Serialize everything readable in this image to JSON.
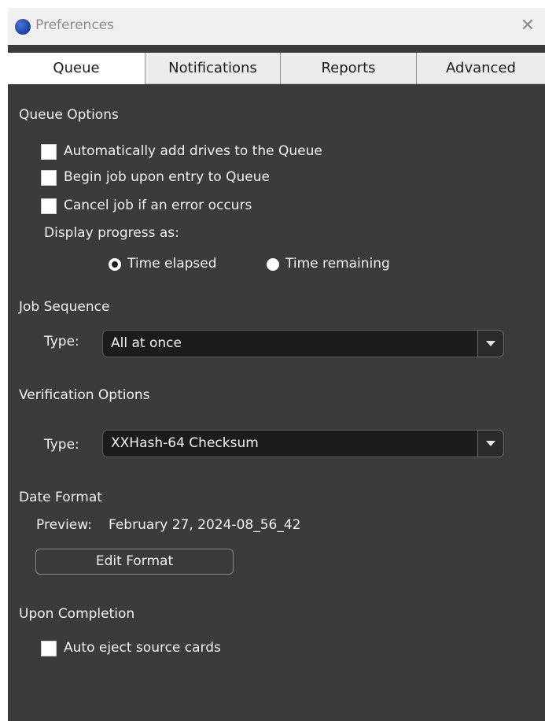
{
  "window": {
    "title": "Preferences",
    "close_glyph": "✕"
  },
  "tabs": [
    {
      "label": "Queue",
      "active": true
    },
    {
      "label": "Notifications",
      "active": false
    },
    {
      "label": "Reports",
      "active": false
    },
    {
      "label": "Advanced",
      "active": false
    }
  ],
  "queue_options": {
    "title": "Queue Options",
    "checkboxes": [
      {
        "label": "Automatically add drives to the Queue",
        "checked": false
      },
      {
        "label": "Begin job upon entry to Queue",
        "checked": false
      },
      {
        "label": "Cancel job if an error occurs",
        "checked": false
      }
    ],
    "progress_label": "Display progress as:",
    "radios": [
      {
        "label": "Time elapsed",
        "selected": true
      },
      {
        "label": "Time remaining",
        "selected": false
      }
    ]
  },
  "job_sequence": {
    "title": "Job Sequence",
    "type_label": "Type:",
    "type_value": "All at once"
  },
  "verification_options": {
    "title": "Verification Options",
    "type_label": "Type:",
    "type_value": "XXHash-64 Checksum"
  },
  "date_format": {
    "title": "Date Format",
    "preview_label": "Preview:",
    "preview_value": "February 27, 2024-08_56_42",
    "edit_button": "Edit Format"
  },
  "upon_completion": {
    "title": "Upon Completion",
    "checkbox": {
      "label": "Auto eject source cards",
      "checked": false
    }
  },
  "colors": {
    "panel_bg": "#3b3b3b",
    "titlebar_bg": "#f0f0f0",
    "dropdown_bg": "#1c1c1c",
    "app_icon": "#2a4fb8"
  },
  "icons": {
    "app": "app-logo-icon",
    "close": "close-icon",
    "dropdown": "chevron-down-icon"
  }
}
